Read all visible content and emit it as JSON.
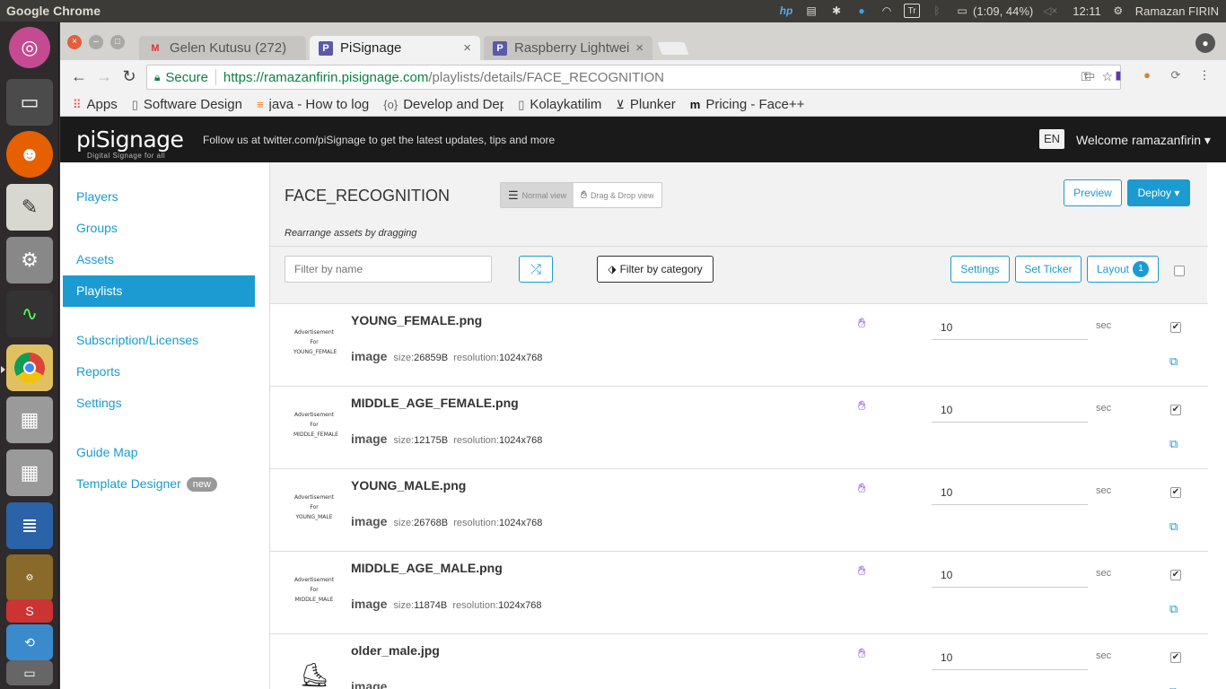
{
  "os": {
    "app_name": "Google Chrome",
    "tray": {
      "battery": "(1:09, 44%)",
      "clock": "12:11",
      "user": "Ramazan FIRIN",
      "keyboard": "Tr"
    }
  },
  "browser": {
    "tabs": [
      {
        "title": "Gelen Kutusu (272)",
        "icon": "gmail-icon"
      },
      {
        "title": "PiSignage",
        "icon": "pisignage-icon"
      },
      {
        "title": "Raspberry Lightwei",
        "icon": "pisignage-icon"
      }
    ],
    "secure_label": "Secure",
    "url_scheme_host": "https://ramazanfirin.pisignage.com",
    "url_path": "/playlists/details/FACE_RECOGNITION",
    "bookmarks": [
      {
        "label": "Apps",
        "icon": "apps-grid-icon"
      },
      {
        "label": "Software Design",
        "icon": "page-icon"
      },
      {
        "label": "java - How to log",
        "icon": "stackoverflow-icon"
      },
      {
        "label": "Develop and Dep",
        "icon": "braces-icon"
      },
      {
        "label": "Kolaykatilim",
        "icon": "page-icon"
      },
      {
        "label": "Plunker",
        "icon": "plunker-icon"
      },
      {
        "label": "Pricing - Face++ C",
        "icon": "facepp-icon"
      }
    ]
  },
  "app": {
    "logo": "piSignage",
    "logo_sub": "Digital Signage for all",
    "follow_text": "Follow us at twitter.com/piSignage to get the latest updates, tips and more",
    "lang": "EN",
    "welcome": "Welcome ramazanfirin ▾"
  },
  "sidebar": {
    "players": "Players",
    "groups": "Groups",
    "assets": "Assets",
    "playlists": "Playlists",
    "subscription": "Subscription/Licenses",
    "reports": "Reports",
    "settings": "Settings",
    "guide_map": "Guide Map",
    "template_designer": "Template Designer",
    "new_badge": "new"
  },
  "playlist": {
    "title": "FACE_RECOGNITION",
    "normal_view": "Normal view",
    "dragdrop_view": "Drag & Drop view",
    "subtitle": "Rearrange assets by dragging",
    "preview": "Preview",
    "deploy": "Deploy ▾",
    "filter_placeholder": "Filter by name",
    "filter_category": "Filter by category",
    "settings": "Settings",
    "set_ticker": "Set Ticker",
    "layout": "Layout",
    "layout_count": "1",
    "sec_label": "sec"
  },
  "assets": [
    {
      "name": "YOUNG_FEMALE.png",
      "type": "image",
      "size_label": "size:",
      "size": "26859B",
      "res_label": "resolution:",
      "resolution": "1024x768",
      "duration": "10",
      "thumb": [
        "Advertisement",
        "For",
        "YOUNG_FEMALE"
      ]
    },
    {
      "name": "MIDDLE_AGE_FEMALE.png",
      "type": "image",
      "size_label": "size:",
      "size": "12175B",
      "res_label": "resolution:",
      "resolution": "1024x768",
      "duration": "10",
      "thumb": [
        "Advertisement",
        "For",
        "MIDDLE_FEMALE"
      ]
    },
    {
      "name": "YOUNG_MALE.png",
      "type": "image",
      "size_label": "size:",
      "size": "26768B",
      "res_label": "resolution:",
      "resolution": "1024x768",
      "duration": "10",
      "thumb": [
        "Advertisement",
        "For",
        "YOUNG_MALE"
      ]
    },
    {
      "name": "MIDDLE_AGE_MALE.png",
      "type": "image",
      "size_label": "size:",
      "size": "11874B",
      "res_label": "resolution:",
      "resolution": "1024x768",
      "duration": "10",
      "thumb": [
        "Advertisement",
        "For",
        "MIDDLE_MALE"
      ]
    },
    {
      "name": "older_male.jpg",
      "type": "image",
      "size_label": "",
      "size": "",
      "res_label": "",
      "resolution": "",
      "duration": "10",
      "thumb": []
    }
  ],
  "colors": {
    "accent": "#1b9bd1",
    "navbar": "#1a1a1a",
    "drag_handle": "#8a4fd8"
  }
}
